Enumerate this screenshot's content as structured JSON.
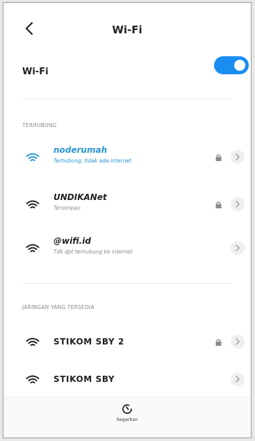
{
  "header": {
    "title": "Wi-Fi",
    "back_icon": "chevron-left-icon"
  },
  "wifi_toggle": {
    "label": "Wi-Fi",
    "state": "on",
    "accent_color": "#1a8ef0"
  },
  "sections": {
    "connected": {
      "label": "TERHUBUNG",
      "networks": [
        {
          "name": "noderumah",
          "status": "Terhubung, tidak ada internet",
          "locked": true,
          "active": true
        },
        {
          "name": "UNDIKANet",
          "status": "Tersimpan",
          "locked": true,
          "active": false
        },
        {
          "name": "@wifi.id",
          "status": "Tdk dpt terhubung ke internet",
          "locked": false,
          "active": false
        }
      ]
    },
    "available": {
      "label": "JARINGAN YANG TERSEDIA",
      "networks": [
        {
          "name": "STIKOM SBY 2",
          "locked": true
        },
        {
          "name": "STIKOM SBY",
          "locked": false
        }
      ]
    }
  },
  "bottom_bar": {
    "refresh_label": "Segarkan",
    "refresh_icon": "refresh-icon"
  },
  "colors": {
    "active_network": "#2a95d4",
    "text_secondary": "#8a8a8a"
  }
}
